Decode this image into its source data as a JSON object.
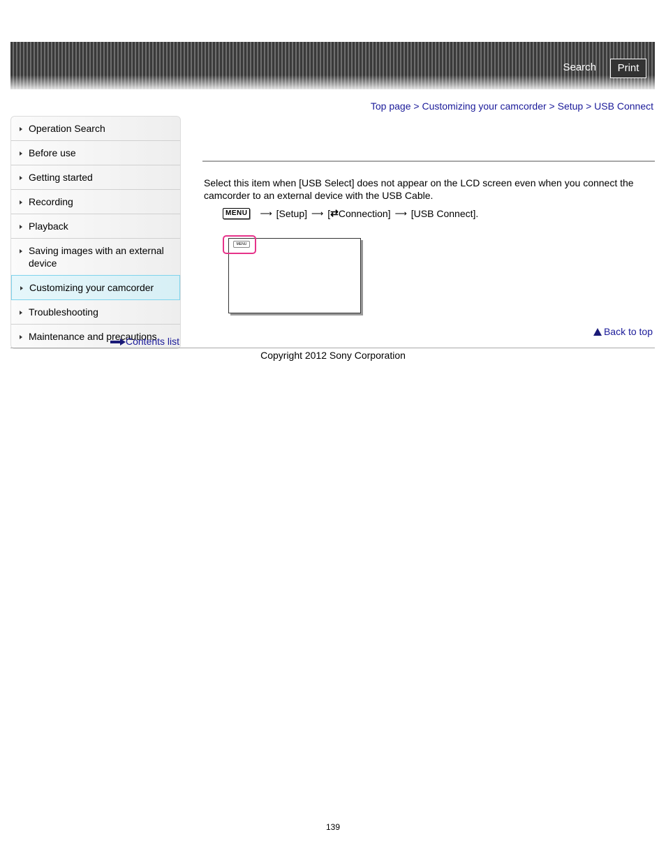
{
  "header": {
    "search_label": "Search",
    "print_label": "Print"
  },
  "breadcrumb": [
    {
      "label": "Top page"
    },
    {
      "label": "Customizing your camcorder"
    },
    {
      "label": "Setup"
    },
    {
      "label": "USB Connect"
    }
  ],
  "breadcrumb_separator": ">",
  "sidebar": {
    "items": [
      {
        "label": "Operation Search",
        "active": false
      },
      {
        "label": "Before use",
        "active": false
      },
      {
        "label": "Getting started",
        "active": false
      },
      {
        "label": "Recording",
        "active": false
      },
      {
        "label": "Playback",
        "active": false
      },
      {
        "label": "Saving images with an external device",
        "active": false
      },
      {
        "label": "Customizing your camcorder",
        "active": true
      },
      {
        "label": "Troubleshooting",
        "active": false
      },
      {
        "label": "Maintenance and precautions",
        "active": false
      }
    ],
    "contents_list_label": "Contents list"
  },
  "main": {
    "description": "Select this item when [USB Select] does not appear on the LCD screen even when you connect the camcorder to an external device with the USB Cable.",
    "steps": {
      "menu_key": "MENU",
      "step1": "[Setup]",
      "step2_prefix": "[",
      "step2_icon": "⇄",
      "step2_text": "Connection]",
      "step3": "[USB Connect].",
      "arrow": "⟶"
    },
    "screen_menu_label": "MENU",
    "highlight_color": "#e6338a"
  },
  "back_to_top_label": "Back to top",
  "copyright": "Copyright 2012 Sony Corporation",
  "page_number": "139"
}
